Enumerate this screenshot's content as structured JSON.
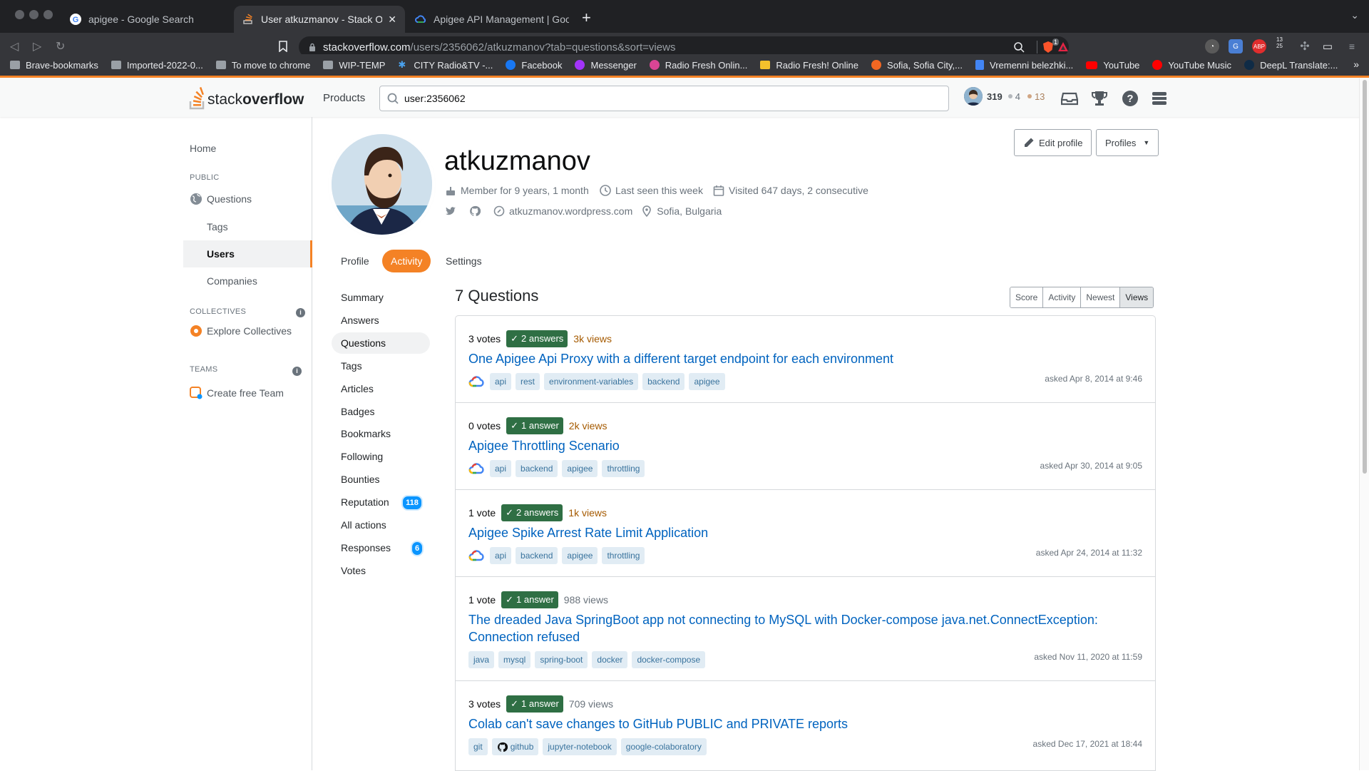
{
  "browser": {
    "tabs": [
      {
        "title": "apigee - Google Search",
        "active": false
      },
      {
        "title": "User atkuzmanov - Stack Overf",
        "active": true
      },
      {
        "title": "Apigee API Management  |  Google C",
        "active": false
      }
    ],
    "new_tab": "+",
    "url_domain": "stackoverflow.com",
    "url_path": "/users/2356062/atkuzmanov?tab=questions&sort=views",
    "ext_badge_brave": "1",
    "ext_abp": "ABP",
    "ext_small": "13 25",
    "bookmarks": [
      {
        "label": "Brave-bookmarks",
        "icon": "folder-icon"
      },
      {
        "label": "Imported-2022-0...",
        "icon": "folder-icon"
      },
      {
        "label": "To move to chrome",
        "icon": "folder-icon"
      },
      {
        "label": "WIP-TEMP",
        "icon": "folder-icon"
      },
      {
        "label": "CITY Radio&TV -...",
        "icon": "city-icon"
      },
      {
        "label": "Facebook",
        "icon": "facebook-icon"
      },
      {
        "label": "Messenger",
        "icon": "messenger-icon"
      },
      {
        "label": "Radio Fresh Onlin...",
        "icon": "radio-icon"
      },
      {
        "label": "Radio Fresh! Online",
        "icon": "radio-icon"
      },
      {
        "label": "Sofia, Sofia City,...",
        "icon": "weather-icon"
      },
      {
        "label": "Vremenni belezhki...",
        "icon": "docs-icon"
      },
      {
        "label": "YouTube",
        "icon": "youtube-icon"
      },
      {
        "label": "YouTube Music",
        "icon": "youtube-music-icon"
      },
      {
        "label": "DeepL Translate:...",
        "icon": "deepl-icon"
      }
    ],
    "bookmarks_more": "»"
  },
  "so_header": {
    "logo_light": "stack",
    "logo_bold": "overflow",
    "products": "Products",
    "search_value": "user:2356062",
    "reputation": "319",
    "silver_badges": "4",
    "bronze_badges": "13"
  },
  "left_nav": {
    "home": "Home",
    "public_heading": "PUBLIC",
    "questions": "Questions",
    "tags": "Tags",
    "users": "Users",
    "companies": "Companies",
    "collectives_heading": "COLLECTIVES",
    "explore_collectives": "Explore Collectives",
    "teams_heading": "TEAMS",
    "create_team": "Create free Team",
    "info": "i"
  },
  "profile": {
    "name": "atkuzmanov",
    "member_for": "Member for 9 years, 1 month",
    "last_seen": "Last seen this week",
    "visited": "Visited 647 days, 2 consecutive",
    "website": "atkuzmanov.wordpress.com",
    "location": "Sofia, Bulgaria",
    "edit_profile": "Edit profile",
    "profiles": "Profiles",
    "tabs": [
      "Profile",
      "Activity",
      "Settings"
    ],
    "active_tab": "Activity"
  },
  "activity_menu": {
    "items": [
      "Summary",
      "Answers",
      "Questions",
      "Tags",
      "Articles",
      "Badges",
      "Bookmarks",
      "Following",
      "Bounties",
      "Reputation",
      "All actions",
      "Responses",
      "Votes"
    ],
    "selected": "Questions",
    "reputation_badge": "118",
    "responses_badge": "6"
  },
  "questions": {
    "heading": "7 Questions",
    "sort_options": [
      "Score",
      "Activity",
      "Newest",
      "Views"
    ],
    "sort_selected": "Views",
    "items": [
      {
        "votes": "3 votes",
        "answers": "2 answers",
        "views": "3k views",
        "hot": true,
        "title": "One Apigee Api Proxy with a different target endpoint for each environment",
        "gcloud": true,
        "tags": [
          "api",
          "rest",
          "environment-variables",
          "backend",
          "apigee"
        ],
        "asked": "asked Apr 8, 2014 at 9:46"
      },
      {
        "votes": "0 votes",
        "answers": "1 answer",
        "views": "2k views",
        "hot": true,
        "title": "Apigee Throttling Scenario",
        "gcloud": true,
        "tags": [
          "api",
          "backend",
          "apigee",
          "throttling"
        ],
        "asked": "asked Apr 30, 2014 at 9:05"
      },
      {
        "votes": "1 vote",
        "answers": "2 answers",
        "views": "1k views",
        "hot": true,
        "title": "Apigee Spike Arrest Rate Limit Application",
        "gcloud": true,
        "tags": [
          "api",
          "backend",
          "apigee",
          "throttling"
        ],
        "asked": "asked Apr 24, 2014 at 11:32"
      },
      {
        "votes": "1 vote",
        "answers": "1 answer",
        "views": "988 views",
        "hot": false,
        "title": "The dreaded Java SpringBoot app not connecting to MySQL with Docker-compose java.net.ConnectException: Connection refused",
        "gcloud": false,
        "tags": [
          "java",
          "mysql",
          "spring-boot",
          "docker",
          "docker-compose"
        ],
        "asked": "asked Nov 11, 2020 at 11:59"
      },
      {
        "votes": "3 votes",
        "answers": "1 answer",
        "views": "709 views",
        "hot": false,
        "title": "Colab can't save changes to GitHub PUBLIC and PRIVATE reports",
        "gcloud": false,
        "github_tag": "github",
        "tags": [
          "git",
          "github",
          "jupyter-notebook",
          "google-colaboratory"
        ],
        "asked": "asked Dec 17, 2021 at 18:44"
      }
    ]
  },
  "colors": {
    "so_orange": "#f48225",
    "link_blue": "#0063bf",
    "answered_green": "#2f6f44",
    "tag_bg": "#e1ecf4",
    "tag_text": "#39739d",
    "hot_views": "#a55a00"
  }
}
